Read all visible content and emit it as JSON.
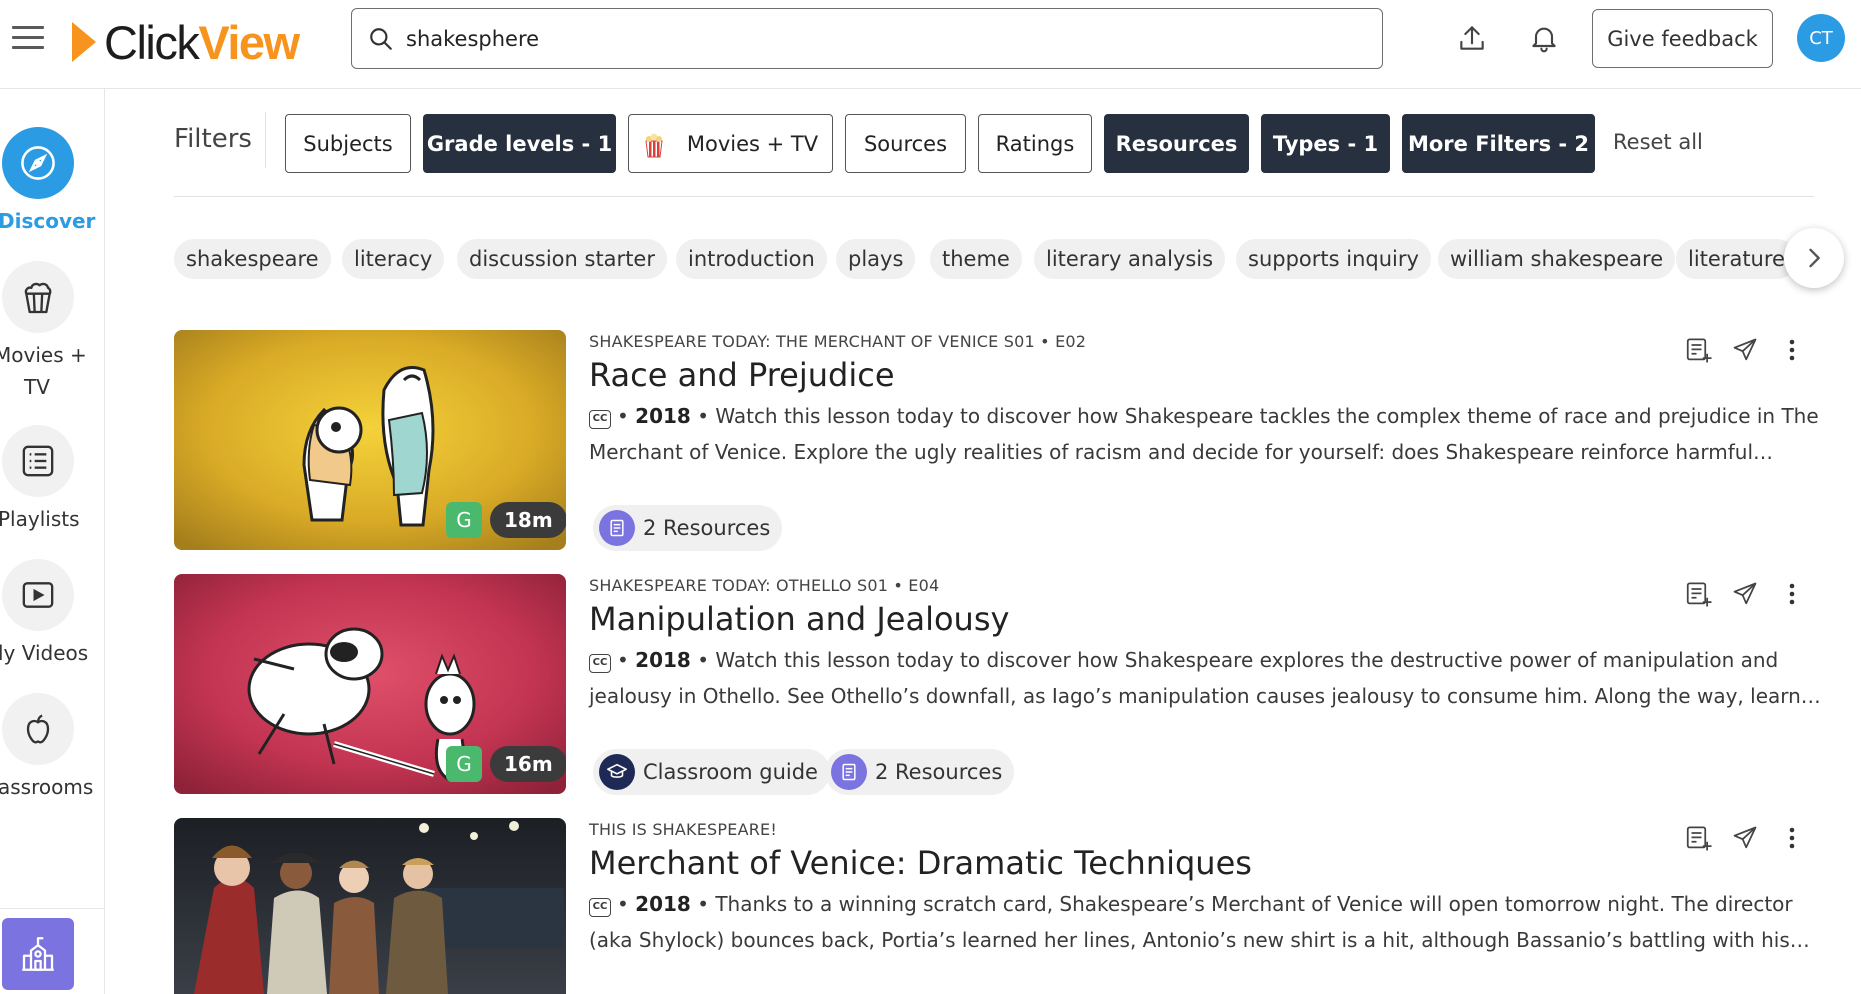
{
  "header": {
    "logo_click": "Click",
    "logo_view": "View",
    "search_value": "shakesphere",
    "feedback_label": "Give feedback",
    "avatar_initials": "CT",
    "accent_color": "#f7941d"
  },
  "sidebar": {
    "items": [
      {
        "label": "Discover",
        "icon": "compass-icon",
        "active": true
      },
      {
        "label": "Movies +",
        "label2": "TV",
        "icon": "popcorn-icon"
      },
      {
        "label": "Playlists",
        "icon": "list-icon"
      },
      {
        "label": "ly Videos",
        "icon": "play-icon"
      },
      {
        "label": "assrooms",
        "icon": "apple-icon"
      }
    ],
    "bottom_icon": "school-icon"
  },
  "filters": {
    "label": "Filters",
    "buttons": [
      {
        "label": "Subjects",
        "active": false
      },
      {
        "label": "Grade levels - 1",
        "active": true
      },
      {
        "label": "Movies + TV",
        "active": false,
        "icon": "popcorn-icon"
      },
      {
        "label": "Sources",
        "active": false
      },
      {
        "label": "Ratings",
        "active": false
      },
      {
        "label": "Resources",
        "active": true
      },
      {
        "label": "Types - 1",
        "active": true
      },
      {
        "label": "More Filters - 2",
        "active": true
      }
    ],
    "reset_label": "Reset all"
  },
  "chips": [
    "shakespeare",
    "literacy",
    "discussion starter",
    "introduction",
    "plays",
    "theme",
    "literary analysis",
    "supports inquiry",
    "william shakespeare",
    "literature"
  ],
  "results": [
    {
      "series": "SHAKESPEARE TODAY: THE MERCHANT OF VENICE S01 • E02",
      "title": "Race and Prejudice",
      "cc": "CC",
      "year": "2018",
      "description": "Watch this lesson today to discover how Shakespeare tackles the complex theme of race and prejudice in The Merchant of Venice. Explore the ugly realities of racism and decide for yourself: does Shakespeare reinforce harmful…",
      "rating": "G",
      "duration": "18m",
      "resources_label": "2 Resources"
    },
    {
      "series": "SHAKESPEARE TODAY: OTHELLO S01 • E04",
      "title": "Manipulation and Jealousy",
      "cc": "CC",
      "year": "2018",
      "description": "Watch this lesson today to discover how Shakespeare explores the destructive power of manipulation and jealousy in Othello. See Othello’s downfall, as Iago’s manipulation causes jealousy to consume him. Along the way, learn…",
      "rating": "G",
      "duration": "16m",
      "guide_label": "Classroom guide",
      "resources_label": "2 Resources"
    },
    {
      "series": "THIS IS SHAKESPEARE!",
      "title": "Merchant of Venice: Dramatic Techniques",
      "cc": "CC",
      "year": "2018",
      "description": "Thanks to a winning scratch card, Shakespeare’s Merchant of Venice will open tomorrow night. The director (aka Shylock) bounces back, Portia’s learned her lines, Antonio’s new shirt is a hit, although Bassanio’s battling with his…"
    }
  ],
  "separator": "•"
}
